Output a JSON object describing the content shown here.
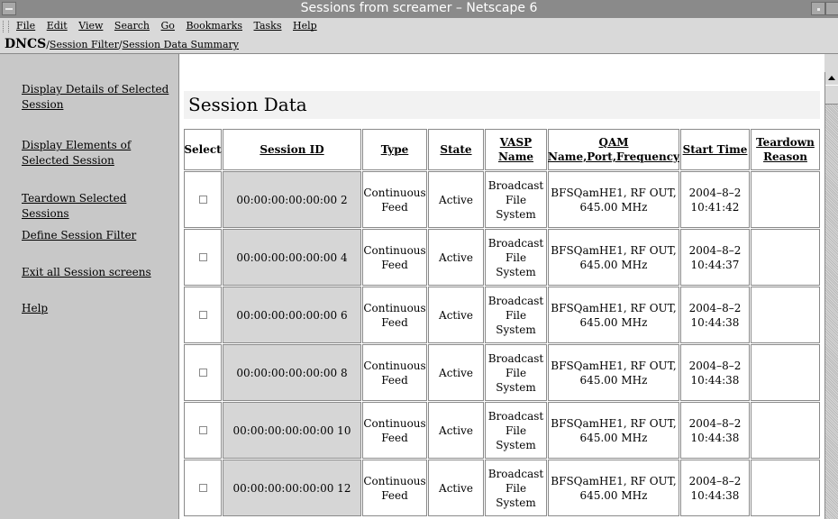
{
  "window": {
    "title": "Sessions from screamer – Netscape 6"
  },
  "menu": [
    {
      "label": "File"
    },
    {
      "label": "Edit"
    },
    {
      "label": "View"
    },
    {
      "label": "Search"
    },
    {
      "label": "Go"
    },
    {
      "label": "Bookmarks"
    },
    {
      "label": "Tasks"
    },
    {
      "label": "Help"
    }
  ],
  "breadcrumb": {
    "root": "DNCS",
    "sep1": "/",
    "item1": "Session Filter",
    "sep2": "/",
    "item2": "Session Data Summary"
  },
  "sidebar": {
    "display_details": "Display Details of Selected Session",
    "display_elements": "Display Elements of Selected Session",
    "teardown": "Teardown Selected Sessions",
    "define_filter": "Define Session Filter",
    "exit_all": "Exit all Session screens",
    "help": "Help"
  },
  "main": {
    "heading": "Session Data"
  },
  "table": {
    "headers": {
      "select": "Select",
      "session_id": "Session ID",
      "type": "Type",
      "state": "State",
      "vasp": "VASP Name",
      "qam": "QAM Name,Port,Frequency",
      "start": "Start Time",
      "teardown": "Teardown Reason"
    },
    "rows": [
      {
        "id": "00:00:00:00:00:00 2",
        "type": "Continuous Feed",
        "state": "Active",
        "vasp": "Broadcast File System",
        "qam": "BFSQamHE1, RF OUT, 645.00 MHz",
        "start": "2004–8–2 10:41:42",
        "reason": ""
      },
      {
        "id": "00:00:00:00:00:00 4",
        "type": "Continuous Feed",
        "state": "Active",
        "vasp": "Broadcast File System",
        "qam": "BFSQamHE1, RF OUT, 645.00 MHz",
        "start": "2004–8–2 10:44:37",
        "reason": ""
      },
      {
        "id": "00:00:00:00:00:00 6",
        "type": "Continuous Feed",
        "state": "Active",
        "vasp": "Broadcast File System",
        "qam": "BFSQamHE1, RF OUT, 645.00 MHz",
        "start": "2004–8–2 10:44:38",
        "reason": ""
      },
      {
        "id": "00:00:00:00:00:00 8",
        "type": "Continuous Feed",
        "state": "Active",
        "vasp": "Broadcast File System",
        "qam": "BFSQamHE1, RF OUT, 645.00 MHz",
        "start": "2004–8–2 10:44:38",
        "reason": ""
      },
      {
        "id": "00:00:00:00:00:00 10",
        "type": "Continuous Feed",
        "state": "Active",
        "vasp": "Broadcast File System",
        "qam": "BFSQamHE1, RF OUT, 645.00 MHz",
        "start": "2004–8–2 10:44:38",
        "reason": ""
      },
      {
        "id": "00:00:00:00:00:00 12",
        "type": "Continuous Feed",
        "state": "Active",
        "vasp": "Broadcast File System",
        "qam": "BFSQamHE1, RF OUT, 645.00 MHz",
        "start": "2004–8–2 10:44:38",
        "reason": ""
      }
    ]
  }
}
